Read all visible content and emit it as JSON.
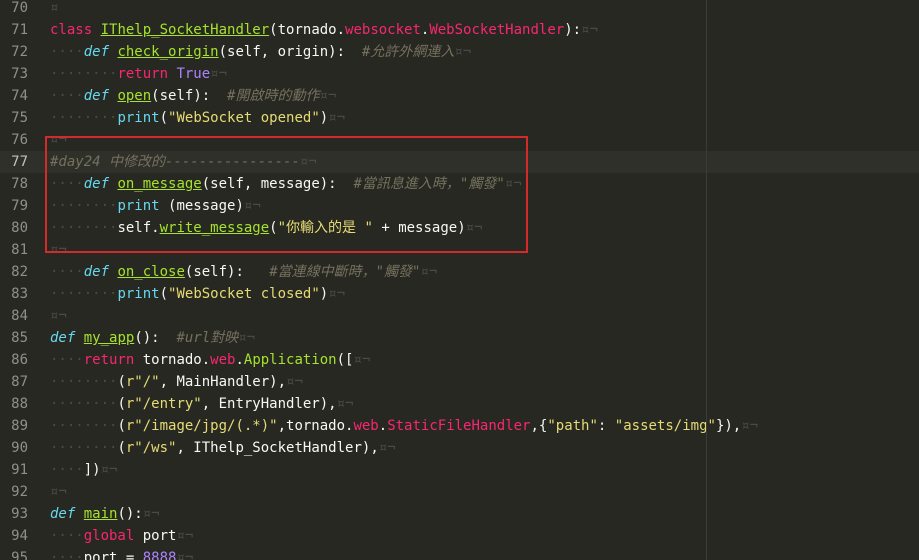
{
  "editor": {
    "active_line": 77,
    "lines": [
      {
        "n": "70",
        "tokens": [
          [
            "eol",
            "¤"
          ]
        ]
      },
      {
        "n": "71",
        "tokens": [
          [
            "kw",
            "class"
          ],
          [
            "txt",
            " "
          ],
          [
            "cls",
            "IThelp_SocketHandler"
          ],
          [
            "txt",
            "(tornado."
          ],
          [
            "attr",
            "websocket"
          ],
          [
            "txt",
            "."
          ],
          [
            "attr",
            "WebSocketHandler"
          ],
          [
            "txt",
            "):"
          ],
          [
            "eol",
            "¤¬"
          ]
        ]
      },
      {
        "n": "72",
        "tokens": [
          [
            "ws",
            "····"
          ],
          [
            "def",
            "def"
          ],
          [
            "txt",
            " "
          ],
          [
            "fnu",
            "check_origin"
          ],
          [
            "txt",
            "(self, origin):  "
          ],
          [
            "cmt",
            "#允許外網連入"
          ],
          [
            "eol",
            "¤¬"
          ]
        ]
      },
      {
        "n": "73",
        "tokens": [
          [
            "ws",
            "········"
          ],
          [
            "kw",
            "return"
          ],
          [
            "txt",
            " "
          ],
          [
            "bool",
            "True"
          ],
          [
            "eol",
            "¤¬"
          ]
        ]
      },
      {
        "n": "74",
        "tokens": [
          [
            "ws",
            "····"
          ],
          [
            "def",
            "def"
          ],
          [
            "txt",
            " "
          ],
          [
            "fnu",
            "open"
          ],
          [
            "txt",
            "(self):  "
          ],
          [
            "cmt",
            "#開啟時的動作"
          ],
          [
            "eol",
            "¤¬"
          ]
        ]
      },
      {
        "n": "75",
        "tokens": [
          [
            "ws",
            "········"
          ],
          [
            "builtin",
            "print"
          ],
          [
            "txt",
            "("
          ],
          [
            "str",
            "\"WebSocket opened\""
          ],
          [
            "txt",
            ")"
          ],
          [
            "eol",
            "¤¬"
          ]
        ]
      },
      {
        "n": "76",
        "tokens": [
          [
            "eol",
            "¤¬"
          ]
        ]
      },
      {
        "n": "77",
        "tokens": [
          [
            "cmt",
            "#day24 中修改的----------------"
          ],
          [
            "eol",
            "¤¬"
          ]
        ]
      },
      {
        "n": "78",
        "tokens": [
          [
            "ws",
            "····"
          ],
          [
            "def",
            "def"
          ],
          [
            "txt",
            " "
          ],
          [
            "fnu",
            "on_message"
          ],
          [
            "txt",
            "(self, message):  "
          ],
          [
            "cmt",
            "#當訊息進入時，\"觸發\""
          ],
          [
            "eol",
            "¤¬"
          ]
        ]
      },
      {
        "n": "79",
        "tokens": [
          [
            "ws",
            "········"
          ],
          [
            "builtin",
            "print"
          ],
          [
            "txt",
            " (message)"
          ],
          [
            "eol",
            "¤¬"
          ]
        ]
      },
      {
        "n": "80",
        "tokens": [
          [
            "ws",
            "········"
          ],
          [
            "txt",
            "self."
          ],
          [
            "fnu",
            "write_message"
          ],
          [
            "txt",
            "("
          ],
          [
            "str",
            "\"你輸入的是 \""
          ],
          [
            "txt",
            " + message)"
          ],
          [
            "eol",
            "¤¬"
          ]
        ]
      },
      {
        "n": "81",
        "tokens": [
          [
            "eol",
            "¤¬"
          ]
        ]
      },
      {
        "n": "82",
        "tokens": [
          [
            "ws",
            "····"
          ],
          [
            "def",
            "def"
          ],
          [
            "txt",
            " "
          ],
          [
            "fnu",
            "on_close"
          ],
          [
            "txt",
            "(self):   "
          ],
          [
            "cmt",
            "#當連線中斷時，\"觸發\""
          ],
          [
            "eol",
            "¤¬"
          ]
        ]
      },
      {
        "n": "83",
        "tokens": [
          [
            "ws",
            "········"
          ],
          [
            "builtin",
            "print"
          ],
          [
            "txt",
            "("
          ],
          [
            "str",
            "\"WebSocket closed\""
          ],
          [
            "txt",
            ")"
          ],
          [
            "eol",
            "¤¬"
          ]
        ]
      },
      {
        "n": "84",
        "tokens": [
          [
            "eol",
            "¤¬"
          ]
        ]
      },
      {
        "n": "85",
        "tokens": [
          [
            "def",
            "def"
          ],
          [
            "txt",
            " "
          ],
          [
            "fnu",
            "my_app"
          ],
          [
            "txt",
            "():  "
          ],
          [
            "cmt",
            "#url對映"
          ],
          [
            "eol",
            "¤¬"
          ]
        ]
      },
      {
        "n": "86",
        "tokens": [
          [
            "ws",
            "····"
          ],
          [
            "kw",
            "return"
          ],
          [
            "txt",
            " tornado."
          ],
          [
            "attr",
            "web"
          ],
          [
            "txt",
            "."
          ],
          [
            "fn",
            "Application"
          ],
          [
            "txt",
            "(["
          ],
          [
            "eol",
            "¤¬"
          ]
        ]
      },
      {
        "n": "87",
        "tokens": [
          [
            "ws",
            "········"
          ],
          [
            "txt",
            "("
          ],
          [
            "str",
            "r\"/\""
          ],
          [
            "txt",
            ", MainHandler),"
          ],
          [
            "eol",
            "¤¬"
          ]
        ]
      },
      {
        "n": "88",
        "tokens": [
          [
            "ws",
            "········"
          ],
          [
            "txt",
            "("
          ],
          [
            "str",
            "r\"/entry\""
          ],
          [
            "txt",
            ", EntryHandler),"
          ],
          [
            "eol",
            "¤¬"
          ]
        ]
      },
      {
        "n": "89",
        "tokens": [
          [
            "ws",
            "········"
          ],
          [
            "txt",
            "("
          ],
          [
            "str",
            "r\"/image/jpg/(.*)\""
          ],
          [
            "txt",
            ",tornado."
          ],
          [
            "attr",
            "web"
          ],
          [
            "txt",
            "."
          ],
          [
            "attr",
            "StaticFileHandler"
          ],
          [
            "txt",
            ",{"
          ],
          [
            "str",
            "\"path\""
          ],
          [
            "txt",
            ": "
          ],
          [
            "str",
            "\"assets/img\""
          ],
          [
            "txt",
            "}),"
          ],
          [
            "eol",
            "¤¬"
          ]
        ]
      },
      {
        "n": "90",
        "tokens": [
          [
            "ws",
            "········"
          ],
          [
            "txt",
            "("
          ],
          [
            "str",
            "r\"/ws\""
          ],
          [
            "txt",
            ", IThelp_SocketHandler),"
          ],
          [
            "eol",
            "¤¬"
          ]
        ]
      },
      {
        "n": "91",
        "tokens": [
          [
            "ws",
            "····"
          ],
          [
            "txt",
            "])"
          ],
          [
            "eol",
            "¤¬"
          ]
        ]
      },
      {
        "n": "92",
        "tokens": [
          [
            "eol",
            "¤¬"
          ]
        ]
      },
      {
        "n": "93",
        "tokens": [
          [
            "def",
            "def"
          ],
          [
            "txt",
            " "
          ],
          [
            "fnu",
            "main"
          ],
          [
            "txt",
            "():"
          ],
          [
            "eol",
            "¤¬"
          ]
        ]
      },
      {
        "n": "94",
        "tokens": [
          [
            "ws",
            "····"
          ],
          [
            "kw",
            "global"
          ],
          [
            "txt",
            " port"
          ],
          [
            "eol",
            "¤¬"
          ]
        ]
      },
      {
        "n": "95",
        "tokens": [
          [
            "ws",
            "····"
          ],
          [
            "txt",
            "port = "
          ],
          [
            "num",
            "8888"
          ],
          [
            "eol",
            "¤¬"
          ]
        ]
      }
    ]
  }
}
